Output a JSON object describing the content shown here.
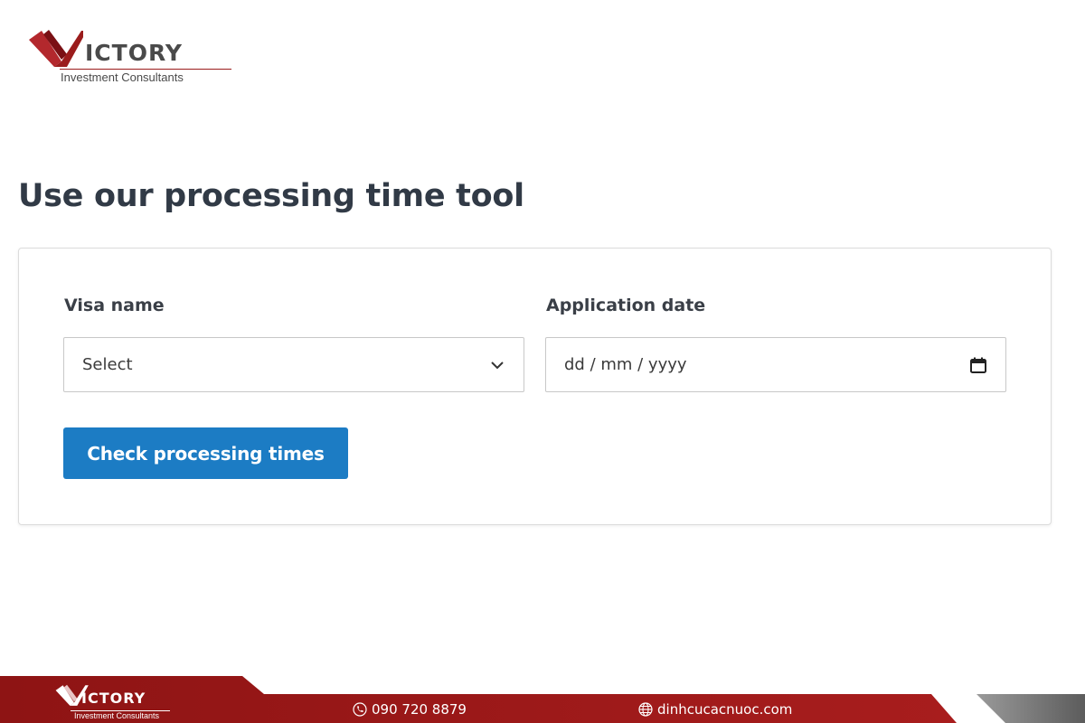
{
  "logo": {
    "word": "ICTORY",
    "tagline": "Investment Consultants"
  },
  "page": {
    "title": "Use our processing time tool"
  },
  "form": {
    "visa_label": "Visa name",
    "visa_value": "Select",
    "date_label": "Application date",
    "date_value": "dd / mm / yyyy",
    "submit_label": "Check processing times"
  },
  "footer": {
    "logo_word": "ICTORY",
    "logo_tagline": "Investment Consultants",
    "phone": "090 720 8879",
    "website": "dinhcucacnuoc.com"
  },
  "colors": {
    "brand_red": "#9b1c1c",
    "button_blue": "#1c7cc4",
    "footer_gray": "#7a7a7a"
  },
  "icons": [
    "chevron-down-icon",
    "calendar-icon",
    "phone-icon",
    "globe-icon"
  ]
}
